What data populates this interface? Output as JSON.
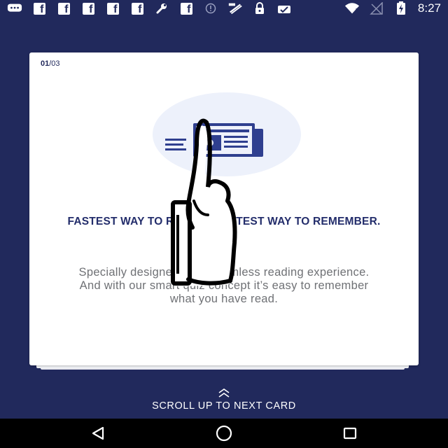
{
  "status_bar": {
    "time": "8:27",
    "fb_letter": "f",
    "left_icons": [
      "message-icon",
      "facebook-icon",
      "facebook-icon",
      "facebook-icon",
      "facebook-icon",
      "facebook-icon",
      "wrench-icon",
      "facebook-icon",
      "info-icon",
      "fast-signal-icon",
      "lock-icon",
      "cloud-icon"
    ],
    "right_icons": [
      "wifi-icon",
      "no-signal-icon",
      "battery-charging-icon"
    ]
  },
  "card": {
    "counter_current": "01",
    "counter_total": "/03",
    "title": "FASTEST WAY TO READ. SMARTEST WAY TO REMEMBER.",
    "body": "Specially designed for a seamless reading experience. And with our smart quiz concept it’s easy to remember what you have read."
  },
  "scroll_hint": {
    "label": "SCROLL UP TO NEXT CARD"
  },
  "colors": {
    "background": "#21295c",
    "title": "#232d6b",
    "body": "#6f7175",
    "accent_icon": "#2f3f8f"
  }
}
